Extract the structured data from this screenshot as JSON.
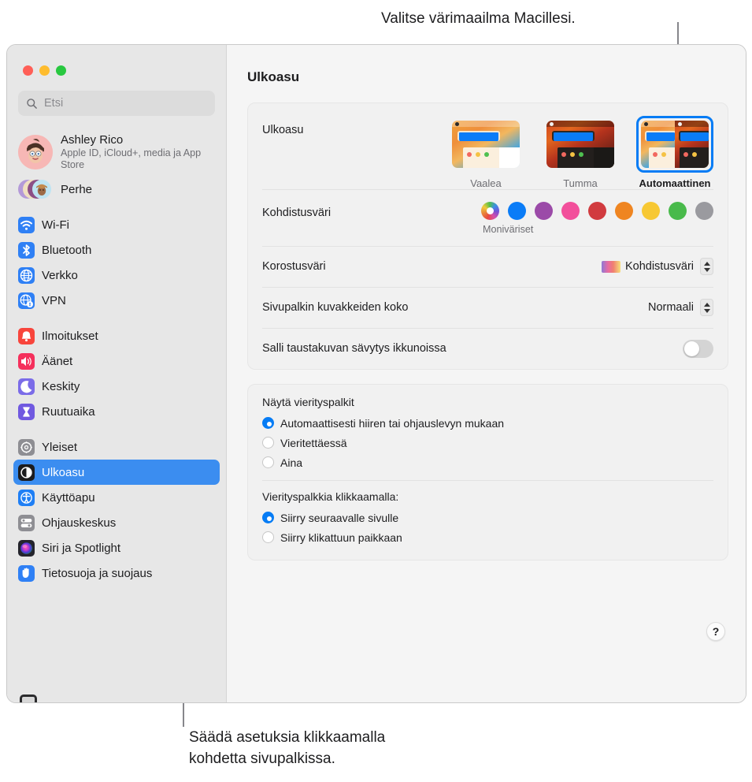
{
  "callouts": {
    "top": "Valitse värimaailma Macillesi.",
    "bottom": "Säädä asetuksia klikkaamalla\nkohdetta sivupalkissa."
  },
  "window": {
    "traffic_lights": {
      "close": "close-button",
      "minimize": "minimize-button",
      "maximize": "maximize-button"
    }
  },
  "sidebar": {
    "search": {
      "placeholder": "Etsi",
      "value": "",
      "icon": "search-icon"
    },
    "account": {
      "name": "Ashley Rico",
      "subtitle": "Apple ID, iCloud+, media ja App Store",
      "avatar": "memoji-avatar"
    },
    "family": {
      "label": "Perhe",
      "icon": "family-avatars-icon"
    },
    "groups": [
      {
        "items": [
          {
            "label": "Wi-Fi",
            "icon": "wifi-icon",
            "color": "#2f80f5"
          },
          {
            "label": "Bluetooth",
            "icon": "bluetooth-icon",
            "color": "#2f80f5"
          },
          {
            "label": "Verkko",
            "icon": "globe-icon",
            "color": "#2f80f5"
          },
          {
            "label": "VPN",
            "icon": "vpn-globe-icon",
            "color": "#2f80f5"
          }
        ]
      },
      {
        "items": [
          {
            "label": "Ilmoitukset",
            "icon": "bell-icon",
            "color": "#f8453c"
          },
          {
            "label": "Äänet",
            "icon": "speaker-icon",
            "color": "#f5305c"
          },
          {
            "label": "Keskity",
            "icon": "moon-icon",
            "color": "#7b6ce8"
          },
          {
            "label": "Ruutuaika",
            "icon": "hourglass-icon",
            "color": "#7059e0"
          }
        ]
      },
      {
        "items": [
          {
            "label": "Yleiset",
            "icon": "gear-icon",
            "color": "#8e8e93"
          },
          {
            "label": "Ulkoasu",
            "icon": "appearance-icon",
            "color": "#1c1c1e",
            "selected": true
          },
          {
            "label": "Käyttöapu",
            "icon": "accessibility-icon",
            "color": "#1f7ff5"
          },
          {
            "label": "Ohjauskeskus",
            "icon": "control-center-icon",
            "color": "#8e8e93"
          },
          {
            "label": "Siri ja Spotlight",
            "icon": "siri-icon",
            "color": "#2b2b35"
          },
          {
            "label": "Tietosuoja ja suojaus",
            "icon": "hand-icon",
            "color": "#2f80f5"
          }
        ]
      }
    ]
  },
  "main": {
    "title": "Ulkoasu",
    "appearance": {
      "label": "Ulkoasu",
      "options": [
        {
          "label": "Vaalea",
          "value": "light",
          "selected": false
        },
        {
          "label": "Tumma",
          "value": "dark",
          "selected": false
        },
        {
          "label": "Automaattinen",
          "value": "auto",
          "selected": true
        }
      ]
    },
    "accent": {
      "label": "Kohdistusväri",
      "caption": "Moniväriset",
      "swatches": [
        {
          "name": "multicolor",
          "color": "multi"
        },
        {
          "name": "blue",
          "color": "#0a7cf7"
        },
        {
          "name": "purple",
          "color": "#9b4aa8"
        },
        {
          "name": "pink",
          "color": "#f24f9b"
        },
        {
          "name": "red",
          "color": "#d13b3f"
        },
        {
          "name": "orange",
          "color": "#ef8521"
        },
        {
          "name": "yellow",
          "color": "#f7c833"
        },
        {
          "name": "green",
          "color": "#49ba4b"
        },
        {
          "name": "graphite",
          "color": "#9a9a9f"
        }
      ],
      "selected": "multicolor"
    },
    "highlight": {
      "label": "Korostusväri",
      "value": "Kohdistusväri",
      "swatch_gradient": "#8e7ad6,#e86ba2,#f08070,#f7e07a"
    },
    "sidebar_icon_size": {
      "label": "Sivupalkin kuvakkeiden koko",
      "value": "Normaali"
    },
    "wallpaper_tinting": {
      "label": "Salli taustakuvan sävytys ikkunoissa",
      "value": "off"
    },
    "show_scrollbars": {
      "label": "Näytä vierityspalkit",
      "options": [
        {
          "label": "Automaattisesti hiiren tai ohjauslevyn mukaan",
          "selected": true
        },
        {
          "label": "Vieritettäessä",
          "selected": false
        },
        {
          "label": "Aina",
          "selected": false
        }
      ]
    },
    "click_scrollbar": {
      "label": "Vierityspalkkia klikkaamalla:",
      "options": [
        {
          "label": "Siirry seuraavalle sivulle",
          "selected": true
        },
        {
          "label": "Siirry klikattuun paikkaan",
          "selected": false
        }
      ]
    },
    "help_button": "?"
  }
}
